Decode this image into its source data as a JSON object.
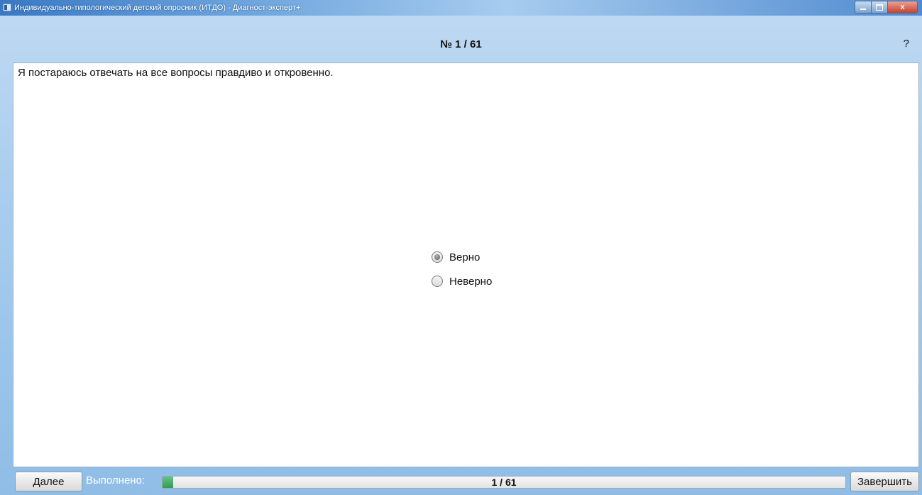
{
  "window": {
    "title": "Индивидуально-типологический детский опросник (ИТДО) - Диагност-эксперт+",
    "icon": "app-window-icon",
    "controls": {
      "minimize": "minimize-icon",
      "maximize": "maximize-icon",
      "close_label": "x"
    }
  },
  "header": {
    "question_number": "№ 1 / 61",
    "help_label": "?"
  },
  "question": {
    "text": "Я постараюсь отвечать на все вопросы правдиво и откровенно.",
    "options": [
      {
        "label": "Верно",
        "selected": true
      },
      {
        "label": "Неверно",
        "selected": false
      }
    ]
  },
  "footer": {
    "next_label": "Далее",
    "done_label": "Выполнено:",
    "progress_text": "1 / 61",
    "progress_fraction": 0.016,
    "finish_label": "Завершить"
  }
}
